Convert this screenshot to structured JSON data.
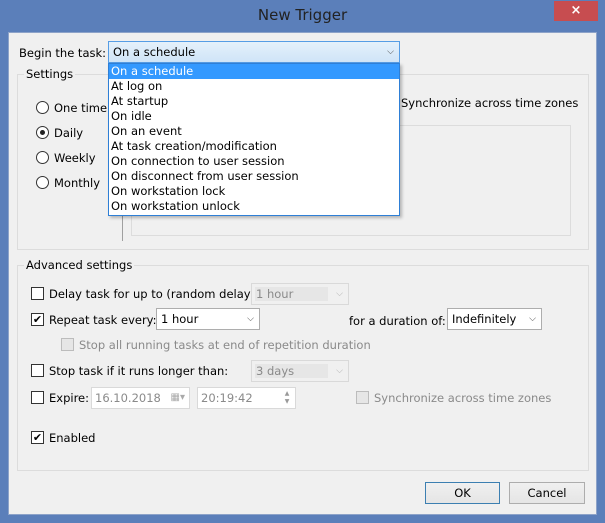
{
  "window": {
    "title": "New Trigger",
    "close_label": "×"
  },
  "begin_task": {
    "label": "Begin the task:",
    "selected": "On a schedule",
    "options": [
      "On a schedule",
      "At log on",
      "At startup",
      "On idle",
      "On an event",
      "At task creation/modification",
      "On connection to user session",
      "On disconnect from user session",
      "On workstation lock",
      "On workstation unlock"
    ]
  },
  "settings": {
    "title": "Settings",
    "radios": [
      {
        "label": "One time",
        "checked": false
      },
      {
        "label": "Daily",
        "checked": true
      },
      {
        "label": "Weekly",
        "checked": false
      },
      {
        "label": "Monthly",
        "checked": false
      }
    ],
    "sync_label": "Synchronize across time zones"
  },
  "advanced": {
    "title": "Advanced settings",
    "delay": {
      "label": "Delay task for up to (random delay):",
      "checked": false,
      "value": "1 hour"
    },
    "repeat": {
      "label": "Repeat task every:",
      "checked": true,
      "value": "1 hour",
      "duration_label": "for a duration of:",
      "duration_value": "Indefinitely"
    },
    "stop_all": {
      "label": "Stop all running tasks at end of repetition duration",
      "checked": false
    },
    "stop_if": {
      "label": "Stop task if it runs longer than:",
      "checked": false,
      "value": "3 days"
    },
    "expire": {
      "label": "Expire:",
      "checked": false,
      "date": "16.10.2018",
      "time": "20:19:42",
      "sync_label": "Synchronize across time zones"
    },
    "enabled": {
      "label": "Enabled",
      "checked": true
    }
  },
  "buttons": {
    "ok": "OK",
    "cancel": "Cancel"
  },
  "glyphs": {
    "check": "✔",
    "chevron": "⌄",
    "calendar": "▦",
    "spin_up": "▲",
    "spin_down": "▼"
  }
}
